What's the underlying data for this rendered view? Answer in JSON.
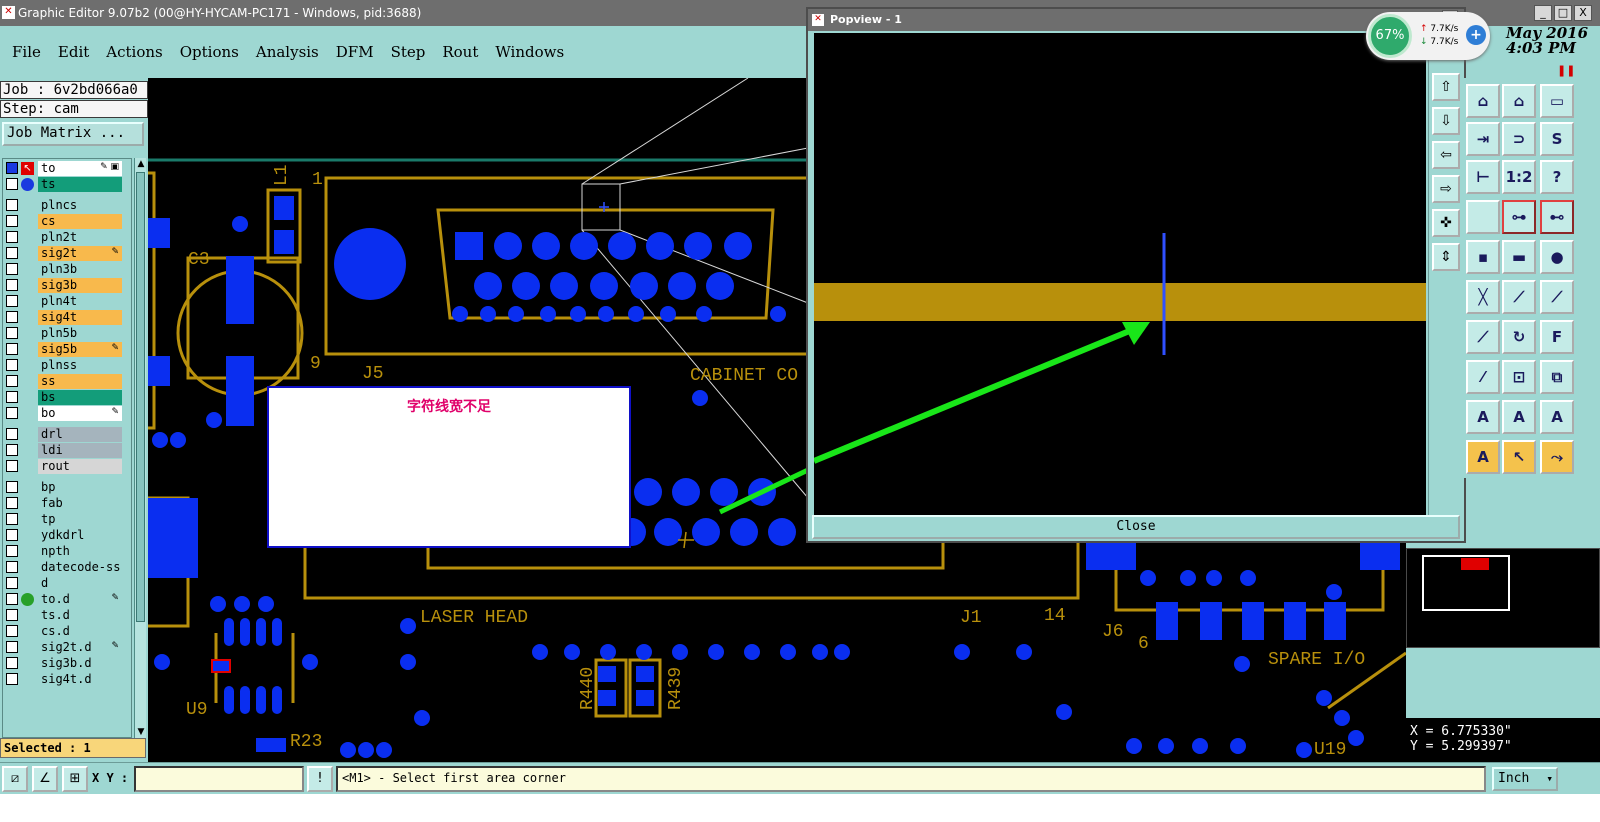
{
  "window": {
    "title": "Graphic Editor 9.07b2 (00@HY-HYCAM-PC171 - Windows, pid:3688)",
    "buttons": [
      "_",
      "□",
      "X"
    ]
  },
  "menu": [
    "File",
    "Edit",
    "Actions",
    "Options",
    "Analysis",
    "DFM",
    "Step",
    "Rout",
    "Windows"
  ],
  "datetime": {
    "date": "May 2016",
    "time": "4:03 PM"
  },
  "job": {
    "job_label": "Job : 6v2bd066a0",
    "step_label": "Step: cam",
    "matrix_button": "Job Matrix ..."
  },
  "layers": [
    {
      "name": "to",
      "color": "#ffffff",
      "flag": "✎ ▣",
      "icon": "cursor",
      "icon_color": "#e00000"
    },
    {
      "name": "ts",
      "color": "#139d7a",
      "flag": "",
      "icon": "dot",
      "icon_color": "#1a3ae0"
    },
    {
      "name": "plncs",
      "color": "#9ed7d2",
      "flag": "",
      "icon": "",
      "icon_color": ""
    },
    {
      "name": "cs",
      "color": "#f8b94c",
      "flag": "",
      "icon": "",
      "icon_color": ""
    },
    {
      "name": "pln2t",
      "color": "#9ed7d2",
      "flag": "",
      "icon": "",
      "icon_color": ""
    },
    {
      "name": "sig2t",
      "color": "#f8b94c",
      "flag": "✎",
      "icon": "",
      "icon_color": ""
    },
    {
      "name": "pln3b",
      "color": "#9ed7d2",
      "flag": "",
      "icon": "",
      "icon_color": ""
    },
    {
      "name": "sig3b",
      "color": "#f8b94c",
      "flag": "",
      "icon": "",
      "icon_color": ""
    },
    {
      "name": "pln4t",
      "color": "#9ed7d2",
      "flag": "",
      "icon": "",
      "icon_color": ""
    },
    {
      "name": "sig4t",
      "color": "#f8b94c",
      "flag": "",
      "icon": "",
      "icon_color": ""
    },
    {
      "name": "pln5b",
      "color": "#9ed7d2",
      "flag": "",
      "icon": "",
      "icon_color": ""
    },
    {
      "name": "sig5b",
      "color": "#f8b94c",
      "flag": "✎",
      "icon": "",
      "icon_color": ""
    },
    {
      "name": "plnss",
      "color": "#9ed7d2",
      "flag": "",
      "icon": "",
      "icon_color": ""
    },
    {
      "name": "ss",
      "color": "#f8b94c",
      "flag": "",
      "icon": "",
      "icon_color": ""
    },
    {
      "name": "bs",
      "color": "#139d7a",
      "flag": "",
      "icon": "",
      "icon_color": ""
    },
    {
      "name": "bo",
      "color": "#ffffff",
      "flag": "✎",
      "icon": "",
      "icon_color": ""
    },
    {
      "name": "drl",
      "color": "#a5b4bd",
      "flag": "",
      "icon": "",
      "icon_color": ""
    },
    {
      "name": "ldi",
      "color": "#a5b4bd",
      "flag": "",
      "icon": "",
      "icon_color": ""
    },
    {
      "name": "rout",
      "color": "#d6d6d6",
      "flag": "",
      "icon": "",
      "icon_color": ""
    },
    {
      "name": "bp",
      "color": "#9ed7d2",
      "flag": "",
      "icon": "",
      "icon_color": ""
    },
    {
      "name": "fab",
      "color": "#9ed7d2",
      "flag": "",
      "icon": "",
      "icon_color": ""
    },
    {
      "name": "tp",
      "color": "#9ed7d2",
      "flag": "",
      "icon": "",
      "icon_color": ""
    },
    {
      "name": "ydkdrl",
      "color": "#9ed7d2",
      "flag": "",
      "icon": "",
      "icon_color": ""
    },
    {
      "name": "npth",
      "color": "#9ed7d2",
      "flag": "",
      "icon": "",
      "icon_color": ""
    },
    {
      "name": "datecode-ss",
      "color": "#9ed7d2",
      "flag": "",
      "icon": "",
      "icon_color": ""
    },
    {
      "name": "d",
      "color": "#9ed7d2",
      "flag": "",
      "icon": "",
      "icon_color": ""
    },
    {
      "name": "to.d",
      "color": "#9ed7d2",
      "flag": "✎",
      "icon": "dot",
      "icon_color": "#28a028"
    },
    {
      "name": "ts.d",
      "color": "#9ed7d2",
      "flag": "",
      "icon": "",
      "icon_color": ""
    },
    {
      "name": "cs.d",
      "color": "#9ed7d2",
      "flag": "",
      "icon": "",
      "icon_color": ""
    },
    {
      "name": "sig2t.d",
      "color": "#9ed7d2",
      "flag": "✎",
      "icon": "",
      "icon_color": ""
    },
    {
      "name": "sig3b.d",
      "color": "#9ed7d2",
      "flag": "",
      "icon": "",
      "icon_color": ""
    },
    {
      "name": "sig4t.d",
      "color": "#9ed7d2",
      "flag": "",
      "icon": "",
      "icon_color": ""
    }
  ],
  "selected": "Selected : 1",
  "board_labels": {
    "c3": "C3",
    "l1": "L1",
    "one": "1",
    "nine": "9",
    "j5": "J5",
    "cabinet": "CABINET CO",
    "laser": "LASER HEAD",
    "j1": "J1",
    "fourteen": "14",
    "j6": "J6",
    "six": "6",
    "spare": "SPARE I/O",
    "u9": "U9",
    "r23": "R23",
    "r440": "R440",
    "r439": "R439",
    "u19": "U19"
  },
  "note": "字符线宽不足",
  "popview": {
    "title": "Popview - 1",
    "close": "Close",
    "close_x": "X"
  },
  "netmon": {
    "percent": "67%",
    "up": "7.7K/s",
    "down": "7.7K/s",
    "up_arrow": "↑",
    "down_arrow": "↓",
    "plus": "+"
  },
  "coords": {
    "x": "X = 6.775330\"",
    "y": "Y = 5.299397\""
  },
  "bottom": {
    "xy_label": "X Y :",
    "xy_value": "",
    "status": "<M1> - Select first area corner",
    "unit": "Inch"
  },
  "colors": {
    "copper": "#b8900c",
    "pad": "#0a2ef0",
    "arrow": "#19e619",
    "background": "#000000"
  }
}
